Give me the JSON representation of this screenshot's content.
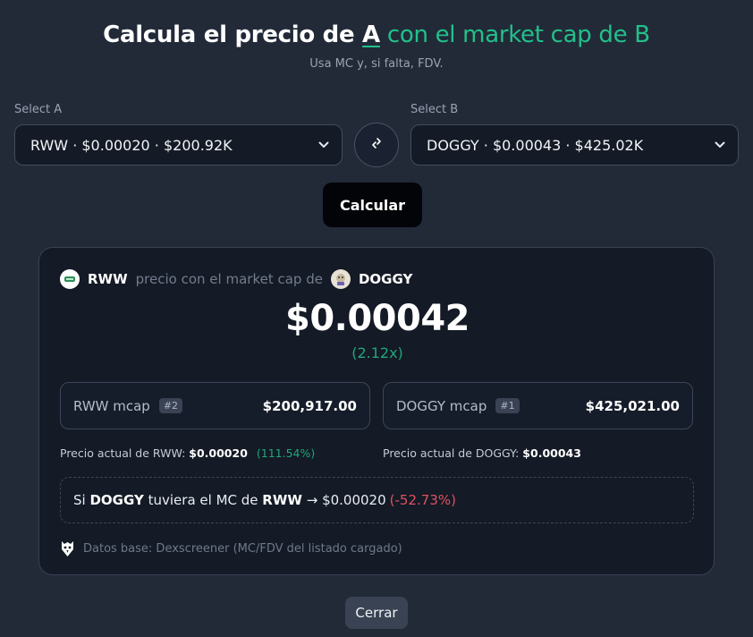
{
  "header": {
    "title_part1": "Calcula el precio de ",
    "title_a": "A",
    "title_part2": " con el market cap de B",
    "subtitle": "Usa MC y, si falta, FDV."
  },
  "select_a": {
    "label": "Select A",
    "value": "RWW · $0.00020 · $200.92K"
  },
  "select_b": {
    "label": "Select B",
    "value": "DOGGY · $0.00043 · $425.02K"
  },
  "swap_icon": "swap-arrows-icon",
  "calculate_label": "Calcular",
  "result": {
    "token_a": "RWW",
    "connector": "precio con el market cap de",
    "token_b": "DOGGY",
    "price": "$0.00042",
    "multiplier": "(2.12x)",
    "mcap_a": {
      "label": "RWW mcap",
      "rank": "#2",
      "value": "$200,917.00"
    },
    "mcap_b": {
      "label": "DOGGY mcap",
      "rank": "#1",
      "value": "$425,021.00"
    },
    "current_a": {
      "label": "Precio actual de RWW:",
      "value": "$0.00020",
      "pct": "(111.54%)"
    },
    "current_b": {
      "label": "Precio actual de DOGGY:",
      "value": "$0.00043"
    },
    "reverse": {
      "si": "Si",
      "token": "DOGGY",
      "mid": "tuviera el MC de",
      "target": "RWW",
      "arrow_value": "→ $0.00020",
      "pct": "(-52.73%)"
    },
    "footnote": "Datos base: Dexscreener (MC/FDV del listado cargado)"
  },
  "close_label": "Cerrar",
  "colors": {
    "accent_green": "#22c08a",
    "negative_red": "#e05260",
    "background": "#222a38",
    "card": "#141a26"
  }
}
